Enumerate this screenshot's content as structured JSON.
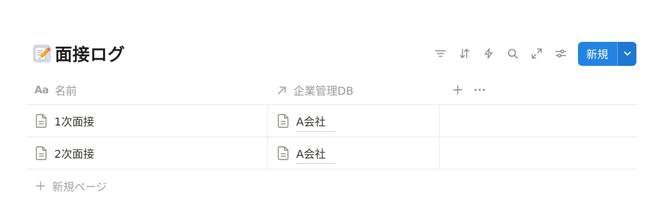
{
  "title": {
    "emoji": "memo-pencil-icon",
    "text": "面接ログ"
  },
  "toolbar": {
    "icons": [
      "filter-icon",
      "sort-icon",
      "lightning-icon",
      "search-icon",
      "expand-icon",
      "settings-sliders-icon"
    ],
    "new_label": "新規"
  },
  "table": {
    "columns": [
      {
        "icon": "Aa",
        "label": "名前"
      },
      {
        "icon": "arrow-up-right-icon",
        "label": "企業管理DB"
      }
    ],
    "rows": [
      {
        "name": "1次面接",
        "company": "A会社"
      },
      {
        "name": "2次面接",
        "company": "A会社"
      }
    ]
  },
  "new_page_label": "新規ページ",
  "colors": {
    "accent": "#2383e2",
    "text": "#37352f",
    "muted": "#9b9a97",
    "border": "#ebeae8"
  }
}
